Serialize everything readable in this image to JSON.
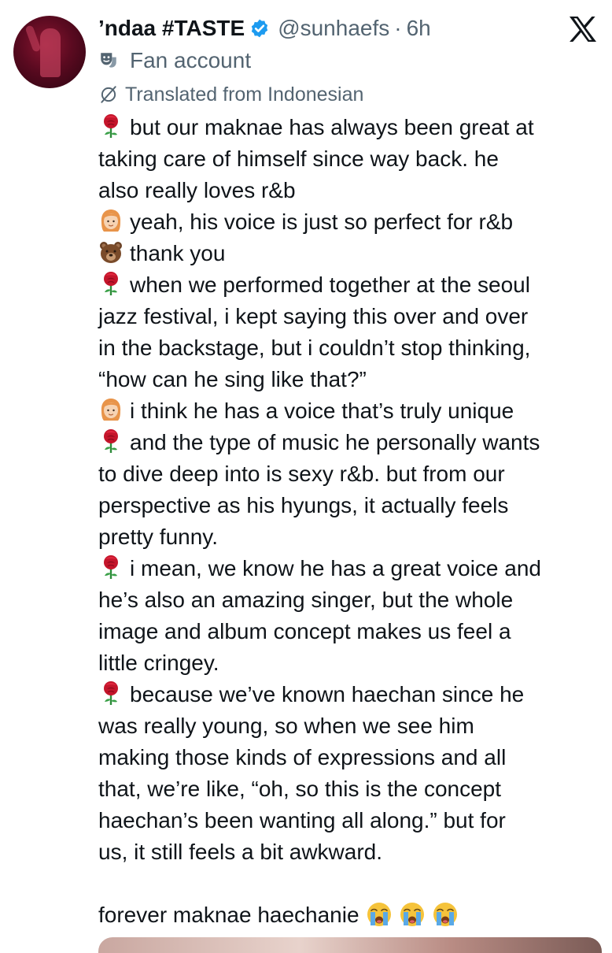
{
  "tweet": {
    "display_name": "’ndaa #TASTE",
    "handle": "@sunhaefs",
    "separator": "·",
    "time": "6h",
    "label": "Fan account",
    "translated": "Translated from Indonesian",
    "lines": [
      {
        "emoji": "rose",
        "text": "but our maknae has always been great at"
      },
      {
        "emoji": "",
        "text": "taking care of himself since way back. he"
      },
      {
        "emoji": "",
        "text": "also really loves r&b"
      },
      {
        "emoji": "woman",
        "text": "yeah, his voice is just so perfect for r&b"
      },
      {
        "emoji": "bear",
        "text": "thank you"
      },
      {
        "emoji": "rose",
        "text": "when we performed together at the seoul"
      },
      {
        "emoji": "",
        "text": "jazz festival, i kept saying this over and over"
      },
      {
        "emoji": "",
        "text": "in the backstage, but i couldn’t stop thinking,"
      },
      {
        "emoji": "",
        "text": "“how can he sing like that?”"
      },
      {
        "emoji": "woman",
        "text": "i think he has a voice that’s truly unique"
      },
      {
        "emoji": "rose",
        "text": "and the type of music he personally wants"
      },
      {
        "emoji": "",
        "text": "to dive deep into is sexy r&b. but from our"
      },
      {
        "emoji": "",
        "text": "perspective as his hyungs, it actually feels"
      },
      {
        "emoji": "",
        "text": "pretty funny."
      },
      {
        "emoji": "rose",
        "text": "i mean, we know he has a great voice and"
      },
      {
        "emoji": "",
        "text": "he’s also an amazing singer, but the whole"
      },
      {
        "emoji": "",
        "text": "image and album concept makes us feel a"
      },
      {
        "emoji": "",
        "text": "little cringey."
      },
      {
        "emoji": "rose",
        "text": "because we’ve known haechan since he"
      },
      {
        "emoji": "",
        "text": "was really young, so when we see him"
      },
      {
        "emoji": "",
        "text": "making those kinds of expressions and all"
      },
      {
        "emoji": "",
        "text": "that, we’re like, “oh, so this is the concept"
      },
      {
        "emoji": "",
        "text": "haechan’s been wanting all along.” but for"
      },
      {
        "emoji": "",
        "text": "us, it still feels a bit awkward."
      }
    ],
    "closing": "forever maknae haechanie",
    "closing_emoji": [
      "loudly-crying-face",
      "loudly-crying-face",
      "loudly-crying-face"
    ]
  },
  "icons": {
    "verified": "verified-badge-icon",
    "platform": "x-logo-icon",
    "label": "theater-mask-icon",
    "translate": "translate-globe-icon"
  },
  "colors": {
    "text": "#0f1419",
    "secondary": "#536471",
    "verified": "#1d9bf0"
  }
}
